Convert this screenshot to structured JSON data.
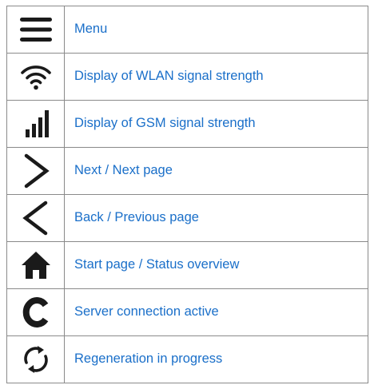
{
  "legend": {
    "rows": [
      {
        "icon": "menu-icon",
        "label": "Menu"
      },
      {
        "icon": "wlan-signal-icon",
        "label": "Display of WLAN signal strength"
      },
      {
        "icon": "gsm-signal-icon",
        "label": "Display of GSM signal strength"
      },
      {
        "icon": "chevron-right-icon",
        "label": "Next / Next page"
      },
      {
        "icon": "chevron-left-icon",
        "label": "Back / Previous page"
      },
      {
        "icon": "home-icon",
        "label": "Start page / Status overview"
      },
      {
        "icon": "server-connection-icon",
        "label": "Server connection active"
      },
      {
        "icon": "regeneration-icon",
        "label": "Regeneration in progress"
      }
    ]
  },
  "colors": {
    "label_text": "#1a6fc9",
    "icon": "#1a1a1a",
    "border": "#8a8a8a"
  }
}
